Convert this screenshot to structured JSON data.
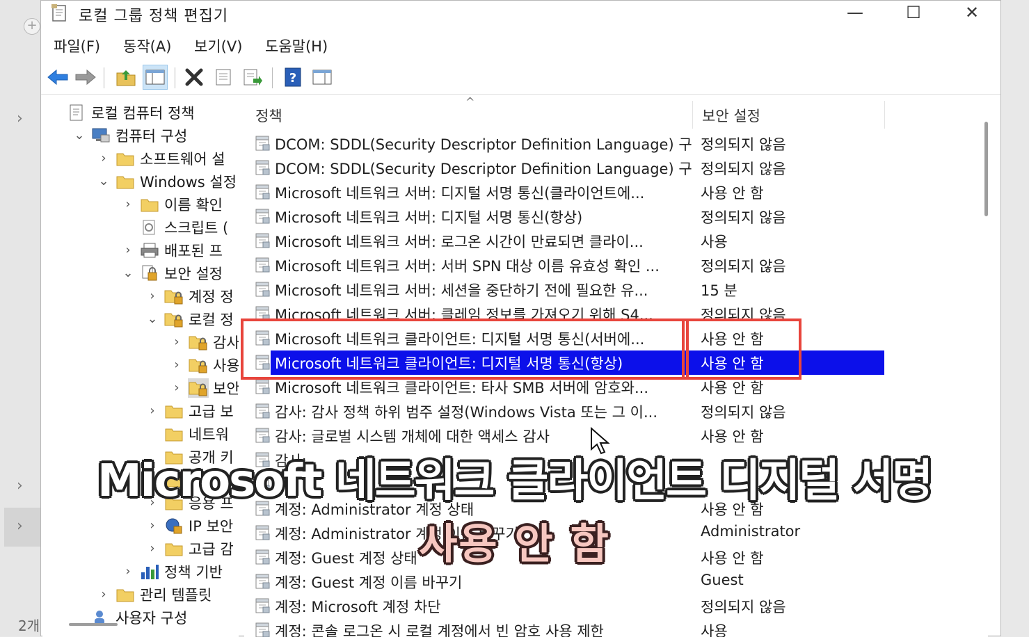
{
  "window": {
    "title": "로컬 그룹 정책 편집기",
    "minimize_glyph": "—",
    "maximize_glyph": "☐",
    "close_glyph": "✕"
  },
  "left_strip": {
    "count_text": "2개"
  },
  "menubar": {
    "items": [
      "파일(F)",
      "동작(A)",
      "보기(V)",
      "도움말(H)"
    ]
  },
  "toolbar": {
    "icons": [
      "back-arrow-icon",
      "forward-arrow-icon",
      "up-folder-icon",
      "show-hide-tree-icon",
      "delete-icon",
      "properties-icon",
      "export-list-icon",
      "help-icon",
      "show-hide-action-pane-icon"
    ]
  },
  "tree": {
    "items": [
      {
        "label": "로컬 컴퓨터 정책",
        "icon": "policy-doc-icon",
        "level": 0,
        "expander": ""
      },
      {
        "label": "컴퓨터 구성",
        "icon": "computer-icon",
        "level": 1,
        "expander": "⌄"
      },
      {
        "label": "소프트웨어 설",
        "icon": "folder-icon",
        "level": 2,
        "expander": "›"
      },
      {
        "label": "Windows 설정",
        "icon": "folder-icon",
        "level": 2,
        "expander": "⌄"
      },
      {
        "label": "이름 확인",
        "icon": "folder-icon",
        "level": 3,
        "expander": "›"
      },
      {
        "label": "스크립트 (",
        "icon": "script-icon",
        "level": 3,
        "expander": ""
      },
      {
        "label": "배포된 프",
        "icon": "printer-icon",
        "level": 3,
        "expander": "›"
      },
      {
        "label": "보안 설정",
        "icon": "security-folder-icon",
        "level": 3,
        "expander": "⌄"
      },
      {
        "label": "계정 정",
        "icon": "lock-folder-icon",
        "level": 4,
        "expander": "›"
      },
      {
        "label": "로컬 정",
        "icon": "lock-folder-icon",
        "level": 4,
        "expander": "⌄"
      },
      {
        "label": "감사",
        "icon": "lock-folder-icon",
        "level": 5,
        "expander": "›"
      },
      {
        "label": "사용",
        "icon": "lock-folder-icon",
        "level": 5,
        "expander": "›"
      },
      {
        "label": "보안",
        "icon": "lock-folder-icon",
        "level": 5,
        "expander": "›",
        "selected": true
      },
      {
        "label": "고급 보",
        "icon": "folder-icon",
        "level": 4,
        "expander": "›"
      },
      {
        "label": "네트워",
        "icon": "folder-icon",
        "level": 4,
        "expander": ""
      },
      {
        "label": "공개 키",
        "icon": "folder-icon",
        "level": 4,
        "expander": ""
      },
      {
        "label": "",
        "icon": "folder-icon",
        "level": 4,
        "expander": ""
      },
      {
        "label": "응용 프",
        "icon": "folder-icon",
        "level": 4,
        "expander": "›"
      },
      {
        "label": "IP 보안",
        "icon": "ip-security-icon",
        "level": 4,
        "expander": "›"
      },
      {
        "label": "고급 감",
        "icon": "folder-icon",
        "level": 4,
        "expander": "›"
      },
      {
        "label": "정책 기반",
        "icon": "chart-bars-icon",
        "level": 3,
        "expander": "›"
      },
      {
        "label": "관리 템플릿",
        "icon": "folder-icon",
        "level": 2,
        "expander": "›"
      },
      {
        "label": "사용자 구성",
        "icon": "user-icon",
        "level": 1,
        "expander": ""
      }
    ]
  },
  "list": {
    "columns": {
      "policy": "정책",
      "setting": "보안 설정"
    },
    "sort_glyph": "^",
    "rows": [
      {
        "policy": "DCOM: SDDL(Security Descriptor Definition Language) 구...",
        "setting": "정의되지 않음"
      },
      {
        "policy": "DCOM: SDDL(Security Descriptor Definition Language) 구...",
        "setting": "정의되지 않음"
      },
      {
        "policy": "Microsoft 네트워크 서버: 디지털 서명 통신(클라이언트에...",
        "setting": "사용 안 함"
      },
      {
        "policy": "Microsoft 네트워크 서버: 디지털 서명 통신(항상)",
        "setting": "정의되지 않음"
      },
      {
        "policy": "Microsoft 네트워크 서버: 로그온 시간이 만료되면 클라이...",
        "setting": "사용"
      },
      {
        "policy": "Microsoft 네트워크 서버: 서버 SPN 대상 이름 유효성 확인 ...",
        "setting": "정의되지 않음"
      },
      {
        "policy": "Microsoft 네트워크 서버: 세션을 중단하기 전에 필요한 유...",
        "setting": "15 분"
      },
      {
        "policy": "Microsoft 네트워크 서버: 클레임 정보를 가져오기 위해 S4...",
        "setting": "정의되지 않음"
      },
      {
        "policy": "Microsoft 네트워크 클라이언트: 디지털 서명 통신(서버에...",
        "setting": "사용 안 함"
      },
      {
        "policy": "Microsoft 네트워크 클라이언트: 디지털 서명 통신(항상)",
        "setting": "사용 안 함",
        "selected": true
      },
      {
        "policy": "Microsoft 네트워크 클라이언트: 타사 SMB 서버에 암호와...",
        "setting": "사용 안 함"
      },
      {
        "policy": "감사: 감사 정책 하위 범주 설정(Windows Vista 또는 그 이...",
        "setting": "정의되지 않음"
      },
      {
        "policy": "감사: 글로벌 시스템 개체에 대한 액세스 감사",
        "setting": "사용 안 함"
      },
      {
        "policy": "감사: ",
        "setting": ""
      },
      {
        "policy": "",
        "setting": ""
      },
      {
        "policy": "계정: Administrator 계정 상태",
        "setting": "사용 안 함"
      },
      {
        "policy": "계정: Administrator 계정 이름 바꾸기",
        "setting": "Administrator"
      },
      {
        "policy": "계정: Guest 계정 상태",
        "setting": "사용 안 함"
      },
      {
        "policy": "계정: Guest 계정 이름 바꾸기",
        "setting": "Guest"
      },
      {
        "policy": "계정: Microsoft 계정 차단",
        "setting": "정의되지 않음"
      },
      {
        "policy": "계정: 콘솔 로그온 시 로컬 계정에서 빈 암호 사용 제한",
        "setting": "사용"
      }
    ]
  },
  "overlay": {
    "caption_line1": "Microsoft 네트워크 클라이언트 디지털 서명",
    "caption_line2": "사용 안 함",
    "highlight_color": "#e8453c",
    "selection_color": "#0c10ea"
  }
}
